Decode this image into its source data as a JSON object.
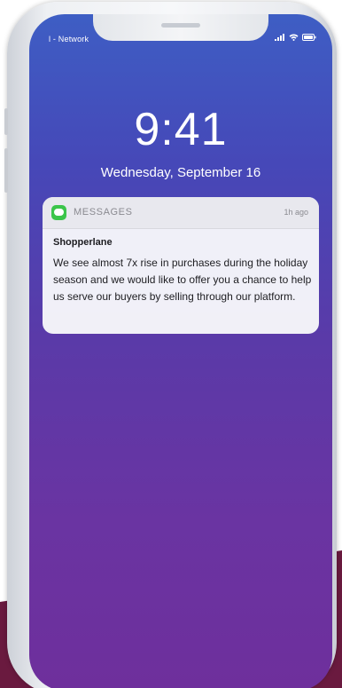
{
  "status_bar": {
    "carrier": "l - Network",
    "icons": [
      "signal-icon",
      "wifi-icon",
      "battery-icon"
    ]
  },
  "lock_screen": {
    "time": "9:41",
    "date": "Wednesday, September 16"
  },
  "notification": {
    "app_name": "MESSAGES",
    "app_icon": "messages-icon",
    "time_ago": "1h ago",
    "sender": "Shopperlane",
    "message": "We see almost 7x rise in purchases during the holiday season and we would like to offer you a chance to help us serve our buyers by selling through our platform."
  },
  "colors": {
    "screen_gradient_top": "#3e5ec4",
    "screen_gradient_bottom": "#6e2f9c",
    "messages_green": "#3bc54a",
    "background_accent": "#6a1a3f"
  }
}
